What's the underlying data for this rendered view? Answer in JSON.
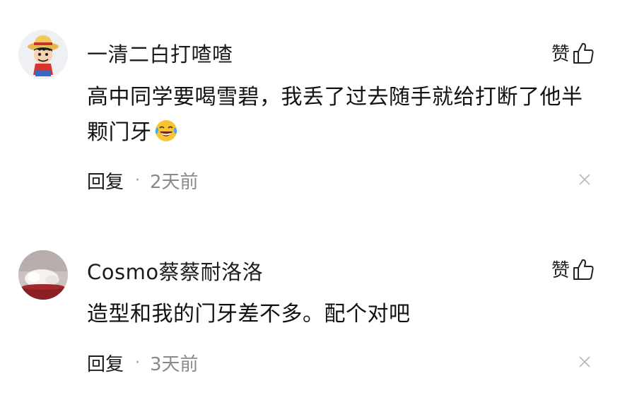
{
  "comments": [
    {
      "username": "一清二白打喳喳",
      "like_label": "赞",
      "text": "高中同学要喝雪碧，我丢了过去随手就给打断了他半颗门牙",
      "emoji": "laughing-crying-emoji",
      "reply_label": "回复",
      "separator": "·",
      "time": "2天前"
    },
    {
      "username": "Cosmo蔡蔡耐洛洛",
      "like_label": "赞",
      "text": "造型和我的门牙差不多。配个对吧",
      "reply_label": "回复",
      "separator": "·",
      "time": "3天前"
    }
  ],
  "colors": {
    "text_primary": "#111111",
    "text_secondary": "#8a8a8a",
    "background": "#ffffff"
  }
}
